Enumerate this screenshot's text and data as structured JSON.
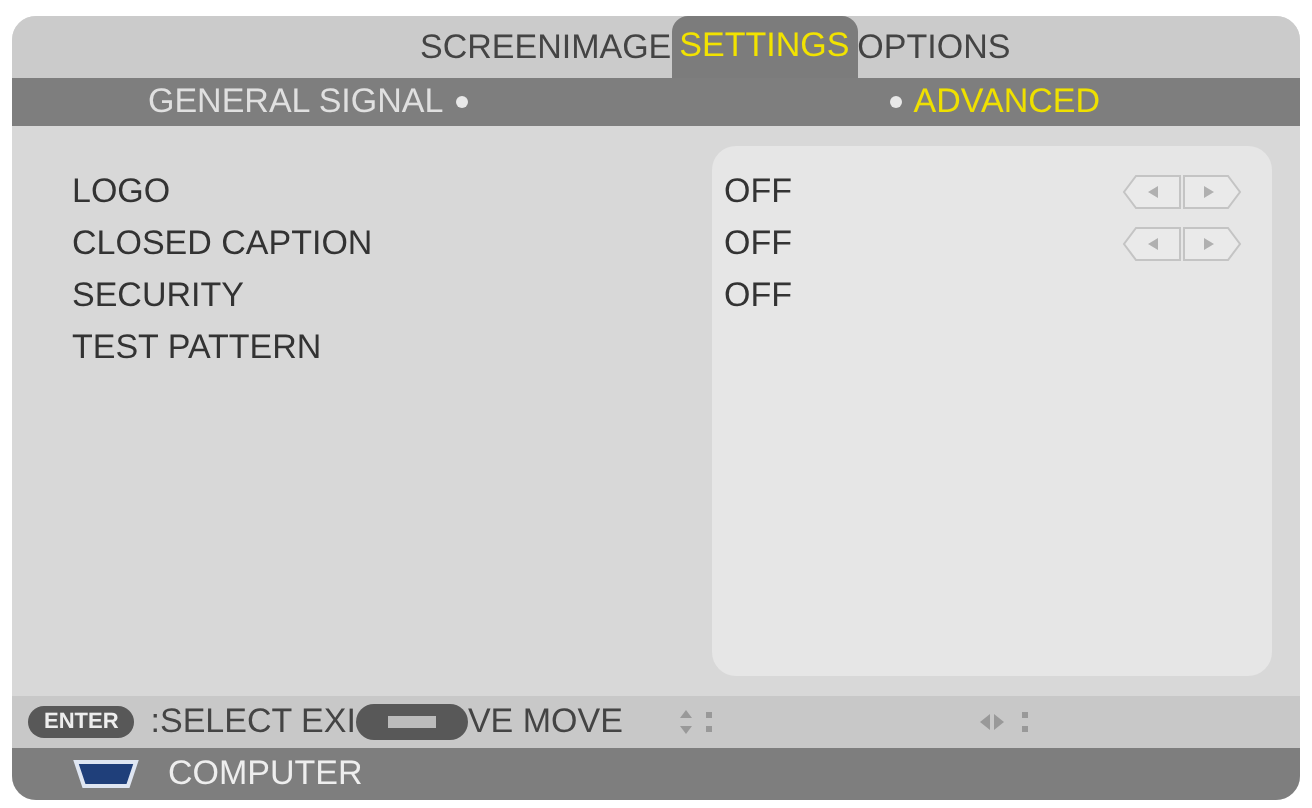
{
  "tabs": [
    {
      "label": "SCREEN",
      "selected": false
    },
    {
      "label": "IMAGE",
      "selected": false
    },
    {
      "label": "SETTINGS",
      "selected": true
    },
    {
      "label": "OPTIONS",
      "selected": false
    }
  ],
  "subtabs": [
    {
      "label": "GENERAL SIGNAL",
      "selected": false
    },
    {
      "label": "ADVANCED",
      "selected": true
    }
  ],
  "settings": [
    {
      "label": "LOGO",
      "value": "OFF",
      "adjustable": true
    },
    {
      "label": "CLOSED CAPTION",
      "value": "OFF",
      "adjustable": true
    },
    {
      "label": "SECURITY",
      "value": "OFF",
      "adjustable": false
    },
    {
      "label": "TEST PATTERN",
      "adjustable": false
    }
  ],
  "footer": {
    "enter_key": "ENTER",
    "hint_before": ":SELECT EXI",
    "hint_after": "VE MOVE"
  },
  "source": "COMPUTER"
}
